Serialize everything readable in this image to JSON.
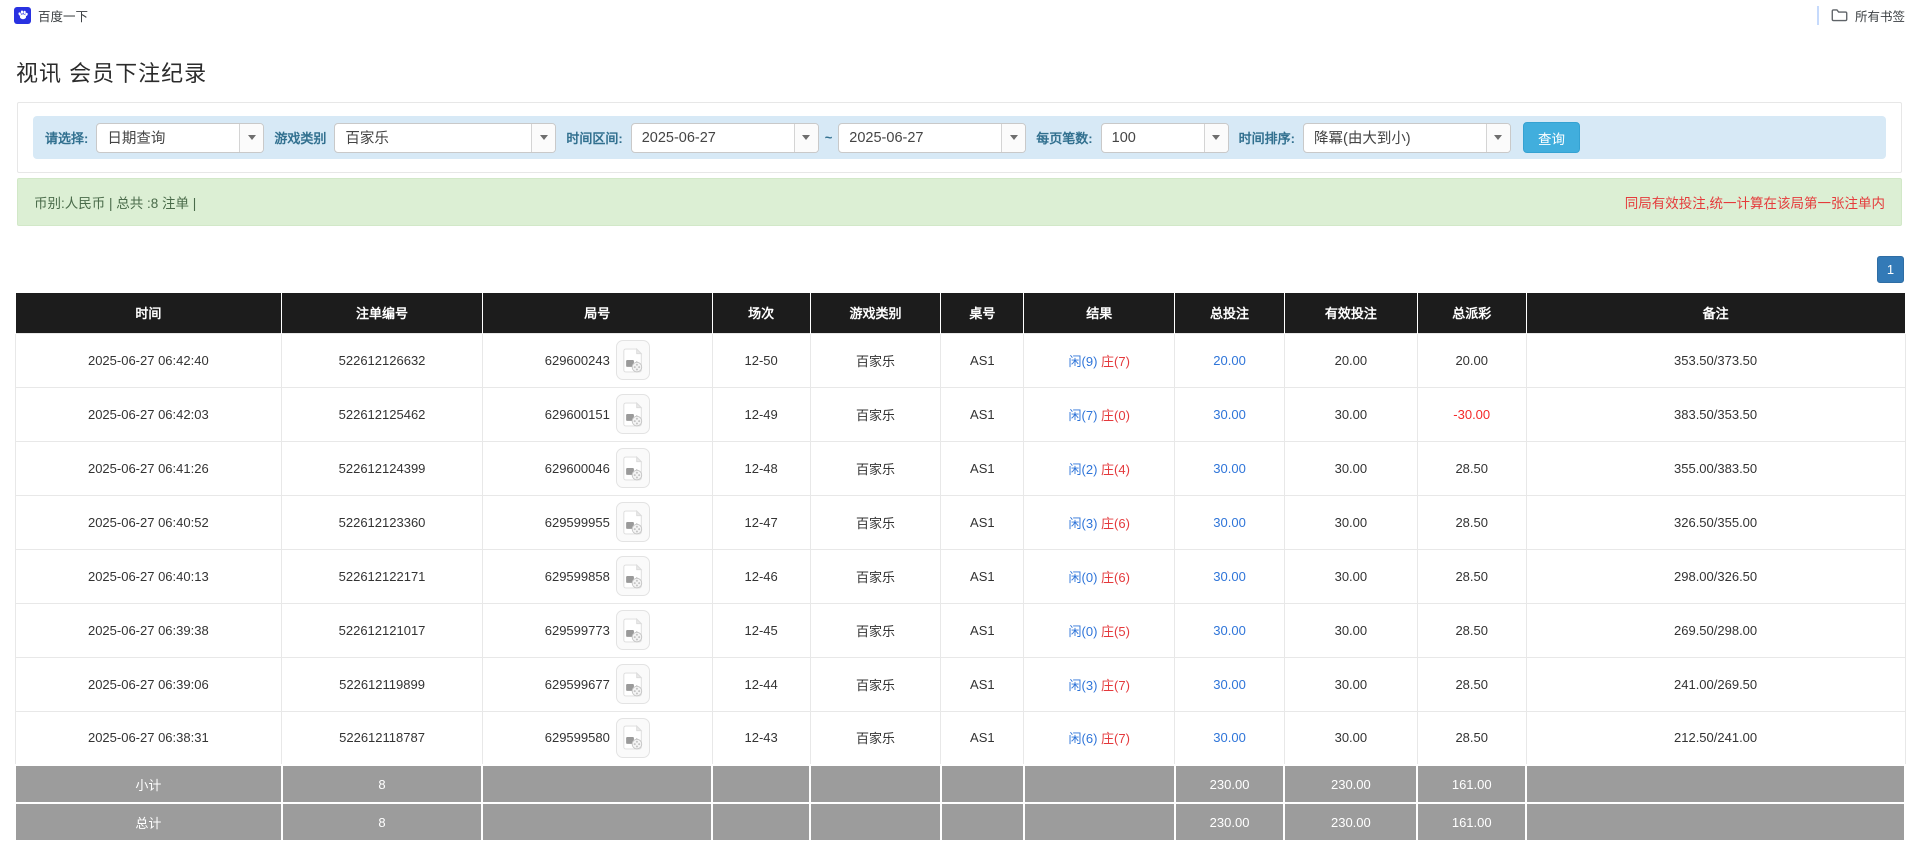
{
  "bookmarks_bar": {
    "bookmark_label": "百度一下",
    "all_bookmarks_label": "所有书签"
  },
  "page": {
    "title": "视讯 会员下注纪录"
  },
  "filters": {
    "select_label": "请选择:",
    "select_value": "日期查询",
    "game_type_label": "游戏类别",
    "game_type_value": "百家乐",
    "date_range_label": "时间区间:",
    "date_from": "2025-06-27",
    "date_separator": "~",
    "date_to": "2025-06-27",
    "page_size_label": "每页笔数:",
    "page_size_value": "100",
    "sort_label": "时间排序:",
    "sort_value": "降冪(由大到小)",
    "query_button_label": "查询"
  },
  "summary_bar": {
    "left_text": "币别:人民币 | 总共 :8 注单 |",
    "right_note": "同局有效投注,统一计算在该局第一张注单内"
  },
  "pagination": {
    "current_page": "1"
  },
  "colors": {
    "header_bg": "#1c1c1c",
    "footer_gray": "#9c9c9c",
    "filter_bar_blue": "#d7e9f6",
    "summary_bar_green": "#dcefd4",
    "query_button_blue": "#41aedd",
    "pagination_blue": "#337ab7",
    "link_blue": "#2f75d9",
    "player_blue": "#2f75d9",
    "banker_red": "#e4393c",
    "negative_red": "#f42a2a",
    "note_red": "#e53b3b"
  },
  "table": {
    "headers": [
      "时间",
      "注单编号",
      "局号",
      "场次",
      "游戏类别",
      "桌号",
      "结果",
      "总投注",
      "有效投注",
      "总派彩",
      "备注"
    ],
    "rows": [
      {
        "time": "2025-06-27 06:42:40",
        "bet_id": "522612126632",
        "round_id": "629600243",
        "session": "12-50",
        "game_type": "百家乐",
        "table_id": "AS1",
        "result_player": "闲(9)",
        "result_banker": "庄(7)",
        "total_bet": "20.00",
        "valid_bet": "20.00",
        "total_payout": "20.00",
        "note": "353.50/373.50"
      },
      {
        "time": "2025-06-27 06:42:03",
        "bet_id": "522612125462",
        "round_id": "629600151",
        "session": "12-49",
        "game_type": "百家乐",
        "table_id": "AS1",
        "result_player": "闲(7)",
        "result_banker": "庄(0)",
        "total_bet": "30.00",
        "valid_bet": "30.00",
        "total_payout": "-30.00",
        "note": "383.50/353.50"
      },
      {
        "time": "2025-06-27 06:41:26",
        "bet_id": "522612124399",
        "round_id": "629600046",
        "session": "12-48",
        "game_type": "百家乐",
        "table_id": "AS1",
        "result_player": "闲(2)",
        "result_banker": "庄(4)",
        "total_bet": "30.00",
        "valid_bet": "30.00",
        "total_payout": "28.50",
        "note": "355.00/383.50"
      },
      {
        "time": "2025-06-27 06:40:52",
        "bet_id": "522612123360",
        "round_id": "629599955",
        "session": "12-47",
        "game_type": "百家乐",
        "table_id": "AS1",
        "result_player": "闲(3)",
        "result_banker": "庄(6)",
        "total_bet": "30.00",
        "valid_bet": "30.00",
        "total_payout": "28.50",
        "note": "326.50/355.00"
      },
      {
        "time": "2025-06-27 06:40:13",
        "bet_id": "522612122171",
        "round_id": "629599858",
        "session": "12-46",
        "game_type": "百家乐",
        "table_id": "AS1",
        "result_player": "闲(0)",
        "result_banker": "庄(6)",
        "total_bet": "30.00",
        "valid_bet": "30.00",
        "total_payout": "28.50",
        "note": "298.00/326.50"
      },
      {
        "time": "2025-06-27 06:39:38",
        "bet_id": "522612121017",
        "round_id": "629599773",
        "session": "12-45",
        "game_type": "百家乐",
        "table_id": "AS1",
        "result_player": "闲(0)",
        "result_banker": "庄(5)",
        "total_bet": "30.00",
        "valid_bet": "30.00",
        "total_payout": "28.50",
        "note": "269.50/298.00"
      },
      {
        "time": "2025-06-27 06:39:06",
        "bet_id": "522612119899",
        "round_id": "629599677",
        "session": "12-44",
        "game_type": "百家乐",
        "table_id": "AS1",
        "result_player": "闲(3)",
        "result_banker": "庄(7)",
        "total_bet": "30.00",
        "valid_bet": "30.00",
        "total_payout": "28.50",
        "note": "241.00/269.50"
      },
      {
        "time": "2025-06-27 06:38:31",
        "bet_id": "522612118787",
        "round_id": "629599580",
        "session": "12-43",
        "game_type": "百家乐",
        "table_id": "AS1",
        "result_player": "闲(6)",
        "result_banker": "庄(7)",
        "total_bet": "30.00",
        "valid_bet": "30.00",
        "total_payout": "28.50",
        "note": "212.50/241.00"
      }
    ],
    "subtotal": {
      "label": "小计",
      "count": "8",
      "total_bet": "230.00",
      "valid_bet": "230.00",
      "total_payout": "161.00"
    },
    "total": {
      "label": "总计",
      "count": "8",
      "total_bet": "230.00",
      "valid_bet": "230.00",
      "total_payout": "161.00"
    }
  }
}
